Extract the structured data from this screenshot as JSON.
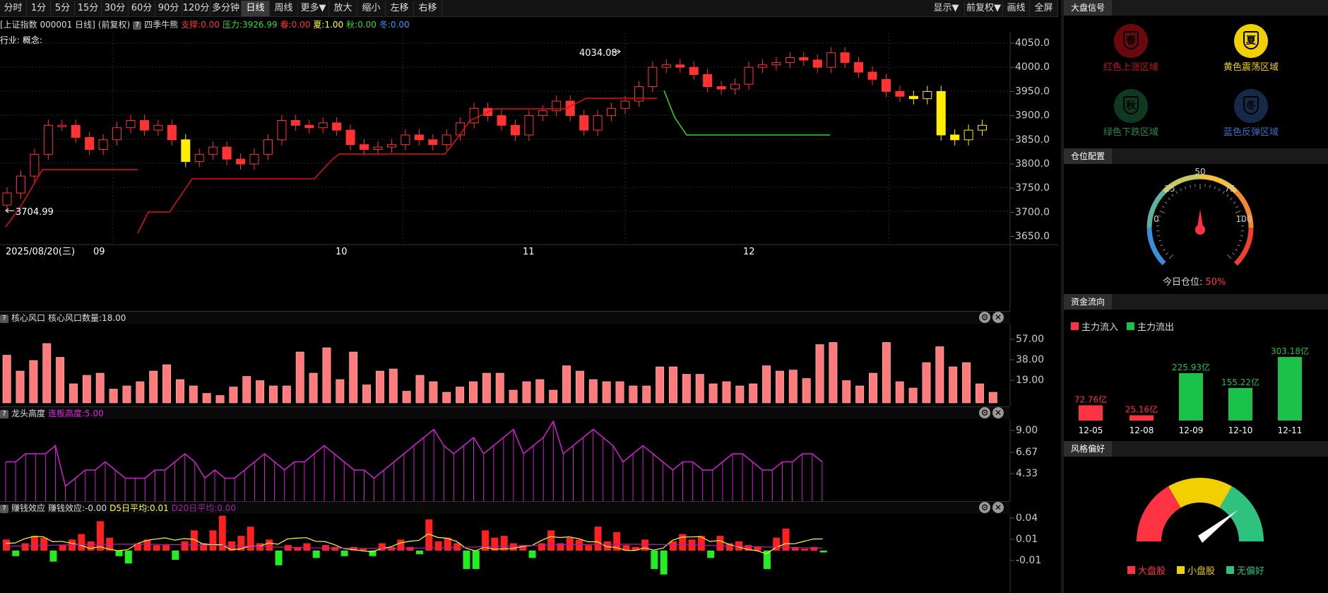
{
  "toolbar": {
    "left_buttons": [
      "分时",
      "1分",
      "5分",
      "15分",
      "30分",
      "60分",
      "90分",
      "120分",
      "多分钟",
      "日线",
      "周线",
      "更多▼",
      "放大",
      "缩小",
      "左移",
      "右移"
    ],
    "active": "日线",
    "right_buttons": [
      "显示▼",
      "前复权▼",
      "画线",
      "全屏"
    ]
  },
  "info": {
    "title": "[上证指数 000001 日线]",
    "adjust": "(前复权)",
    "q_icon": "?",
    "indicator": "四季牛熊",
    "support": "支撑:0.00",
    "pressure": "压力:3926.99",
    "spring": "春:0.00",
    "summer": "夏:1.00",
    "autumn": "秋:0.00",
    "winter": "冬:0.00",
    "industry": "行业: 概念:"
  },
  "main_chart": {
    "high_label": "4034.08",
    "low_label": "3704.99",
    "y_ticks": [
      "4050.0",
      "4000.0",
      "3950.0",
      "3900.0",
      "3850.0",
      "3800.0",
      "3750.0",
      "3700.0",
      "3650.0"
    ],
    "date_label": "2025/08/20(三)",
    "month_labels": [
      "09",
      "10",
      "11",
      "12"
    ]
  },
  "pane1": {
    "title": "核心风口",
    "count": "核心风口数量:18.00",
    "y_ticks": [
      "57.00",
      "38.00",
      "19.00"
    ]
  },
  "pane2": {
    "title": "龙头高度",
    "value": "连板高度:5.00",
    "y_ticks": [
      "9.00",
      "6.67",
      "4.33"
    ]
  },
  "pane3": {
    "title": "赚钱效应",
    "value": "赚钱效应:-0.00",
    "d5": "D5日平均:0.01",
    "d20": "D20日平均:0.00",
    "y_ticks": [
      "0.04",
      "0.01",
      "-0.01"
    ]
  },
  "right_panel": {
    "signal": {
      "header": "大盘信号",
      "items": [
        {
          "glyph": "春",
          "label": "红色上涨区域",
          "color": "#c0121a"
        },
        {
          "glyph": "夏",
          "label": "黄色震荡区域",
          "color": "#f0d000"
        },
        {
          "glyph": "秋",
          "label": "绿色下跌区域",
          "color": "#1d6b3c"
        },
        {
          "glyph": "冬",
          "label": "蓝色反弹区域",
          "color": "#2a4c86"
        }
      ]
    },
    "position": {
      "header": "仓位配置",
      "ticks": [
        "0",
        "25",
        "50",
        "75",
        "100"
      ],
      "label": "今日仓位:",
      "value": "50%"
    },
    "funds": {
      "header": "资金流向",
      "legend_in": "主力流入",
      "legend_out": "主力流出",
      "bars": [
        {
          "date": "12-05",
          "value": "72.76亿",
          "color": "#ff3344",
          "amount": 72.76
        },
        {
          "date": "12-08",
          "value": "25.16亿",
          "color": "#ff3344",
          "amount": 25.16
        },
        {
          "date": "12-09",
          "value": "225.93亿",
          "color": "#1ac24a",
          "amount": 225.93
        },
        {
          "date": "12-10",
          "value": "155.22亿",
          "color": "#1ac24a",
          "amount": 155.22
        },
        {
          "date": "12-11",
          "value": "303.18亿",
          "color": "#1ac24a",
          "amount": 303.18
        }
      ]
    },
    "style": {
      "header": "风格偏好",
      "legend": [
        {
          "label": "大盘股",
          "color": "#ff3344"
        },
        {
          "label": "小盘股",
          "color": "#f0d000"
        },
        {
          "label": "无偏好",
          "color": "#2ec27e"
        }
      ]
    }
  }
}
